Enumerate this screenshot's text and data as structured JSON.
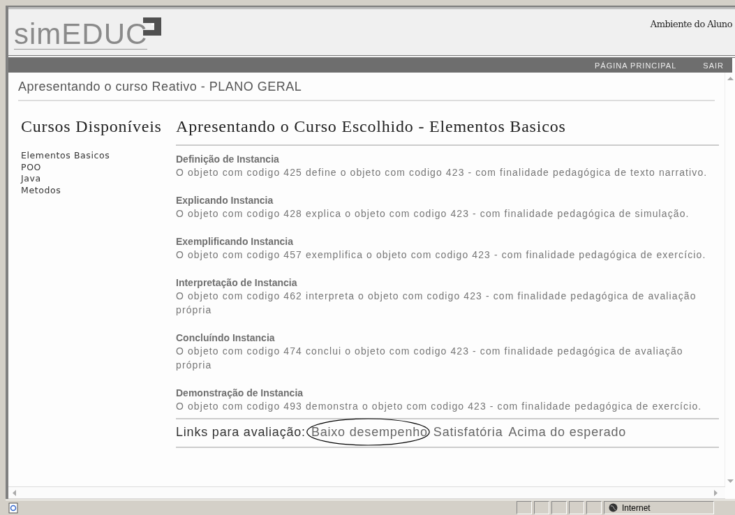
{
  "header": {
    "logo": "simEDUC",
    "area": "Ambiente do Aluno"
  },
  "nav": [
    {
      "label": "PÁGINA PRINCIPAL"
    },
    {
      "label": "SAIR"
    }
  ],
  "page_title": "Apresentando o curso Reativo - PLANO GERAL",
  "sidebar": {
    "title": "Cursos Disponíveis",
    "items": [
      "Elementos Basicos",
      "POO",
      "Java",
      "Metodos"
    ]
  },
  "main": {
    "title": "Apresentando o Curso Escolhido - Elementos Basicos",
    "entries": [
      {
        "title": "Definição de Instancia",
        "text": "O objeto com codigo 425 define o objeto com codigo 423 - com finalidade pedagógica de texto narrativo."
      },
      {
        "title": "Explicando Instancia",
        "text": "O objeto com codigo 428 explica o objeto com codigo 423 - com finalidade pedagógica de simulação."
      },
      {
        "title": "Exemplificando Instancia",
        "text": "O objeto com codigo 457 exemplifica o objeto com codigo 423 - com finalidade pedagógica de exercício."
      },
      {
        "title": "Interpretação de Instancia",
        "text": "O objeto com codigo 462 interpreta o objeto com codigo 423 - com finalidade pedagógica de avaliação própria"
      },
      {
        "title": "Concluíndo Instancia",
        "text": "O objeto com codigo 474 conclui o objeto com codigo 423 - com finalidade pedagógica de avaliação própria"
      },
      {
        "title": "Demonstração de Instancia",
        "text": "O objeto com codigo 493 demonstra o objeto com codigo 423 - com finalidade pedagógica de exercício."
      }
    ],
    "links_label": "Links para avaliação:",
    "links": [
      {
        "label": "Baixo desempenho",
        "circled": true
      },
      {
        "label": "Satisfatória",
        "circled": false
      },
      {
        "label": "Acima do esperado",
        "circled": false
      }
    ]
  },
  "status_bar": {
    "zone": "Internet"
  }
}
